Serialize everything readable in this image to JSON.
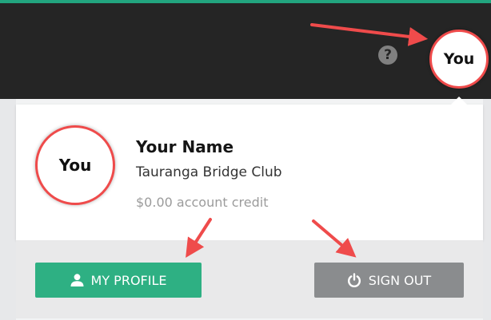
{
  "header": {
    "help_icon": "question-mark-icon",
    "help_glyph": "?",
    "avatar_label": "You"
  },
  "popover": {
    "avatar_label": "You",
    "user_name": "Your Name",
    "club_name": "Tauranga Bridge Club",
    "account_credit": "$0.00 account credit"
  },
  "actions": {
    "profile": {
      "label": "MY PROFILE",
      "icon": "person-icon"
    },
    "sign_out": {
      "label": "SIGN OUT",
      "icon": "power-icon"
    }
  },
  "colors": {
    "accent": "#22a57f",
    "topbar": "#252525",
    "profile_button": "#2eb083",
    "signout_button": "#8a8c8e",
    "annotation": "#ef4b4b"
  }
}
